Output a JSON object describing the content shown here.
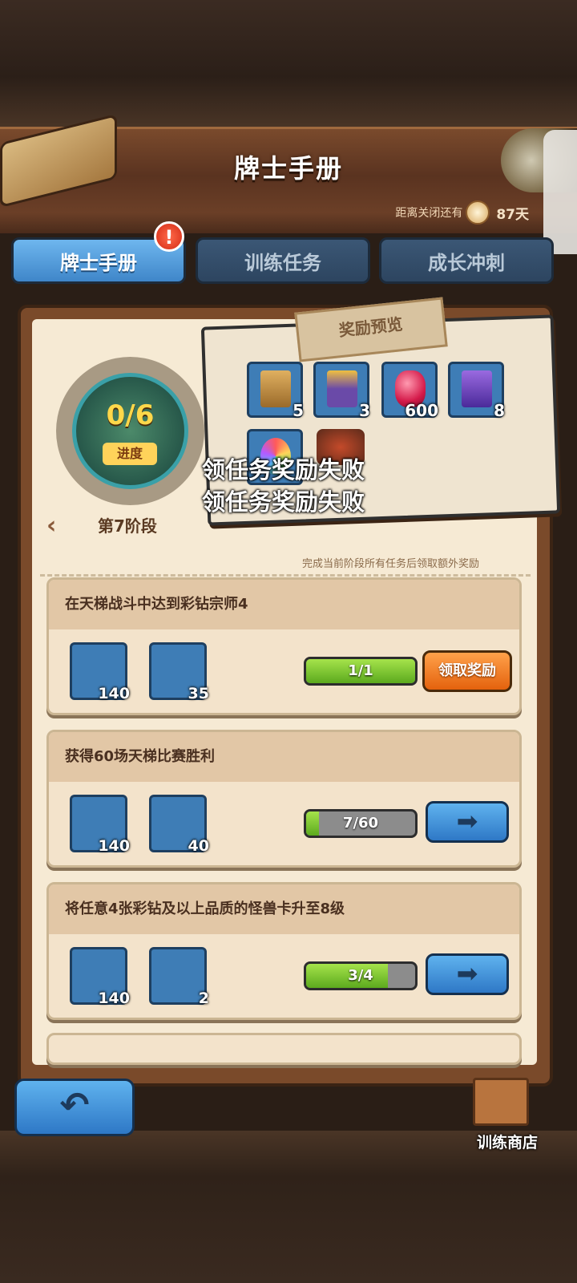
{
  "header": {
    "title": "牌士手册",
    "countdown_label": "距离关闭还有",
    "countdown_value": "87天"
  },
  "tabs": [
    {
      "label": "牌士手册",
      "active": true
    },
    {
      "label": "训练任务",
      "active": false
    },
    {
      "label": "成长冲刺",
      "active": false
    }
  ],
  "alert_badge": "!",
  "progress": {
    "value": "0/6",
    "label": "进度",
    "stage": "第7阶段",
    "hint": "完成当前阶段所有任务后领取额外奖励"
  },
  "reward_preview": {
    "title": "奖励预览",
    "items": [
      {
        "icon": "gold-card-pack-icon",
        "count": "5"
      },
      {
        "icon": "purple-card-pack-icon",
        "count": "3"
      },
      {
        "icon": "ruby-gem-icon",
        "count": "600"
      },
      {
        "icon": "purple-chest-icon",
        "count": "8"
      },
      {
        "icon": "rainbow-badge-icon",
        "count": ""
      },
      {
        "icon": "monster-avatar-icon",
        "count": ""
      }
    ]
  },
  "toasts": [
    "领任务奖励失败",
    "领任务奖励失败"
  ],
  "tasks": [
    {
      "title": "在天梯战斗中达到彩钻宗师4",
      "rewards": [
        {
          "icon": "trainer-token-icon",
          "count": "140"
        },
        {
          "icon": "silver-medal-icon",
          "count": "35"
        }
      ],
      "progress": "1/1",
      "progress_fraction": 1.0,
      "action": "领取奖励",
      "action_type": "claim"
    },
    {
      "title": "获得60场天梯比赛胜利",
      "rewards": [
        {
          "icon": "trainer-token-icon",
          "count": "140"
        },
        {
          "icon": "silver-medal-icon",
          "count": "40"
        }
      ],
      "progress": "7/60",
      "progress_fraction": 0.117,
      "action": "➡",
      "action_type": "go"
    },
    {
      "title": "将任意4张彩钻及以上品质的怪兽卡升至8级",
      "rewards": [
        {
          "icon": "trainer-token-icon",
          "count": "140"
        },
        {
          "icon": "rainbow-medal-icon",
          "count": "2"
        }
      ],
      "progress": "3/4",
      "progress_fraction": 0.75,
      "action": "➡",
      "action_type": "go"
    }
  ],
  "footer": {
    "back_icon": "↶",
    "shop_label": "训练商店"
  },
  "colors": {
    "tab_active": "#4f9bdc",
    "claim_orange": "#f08a2a",
    "progress_green": "#7cc52e"
  }
}
